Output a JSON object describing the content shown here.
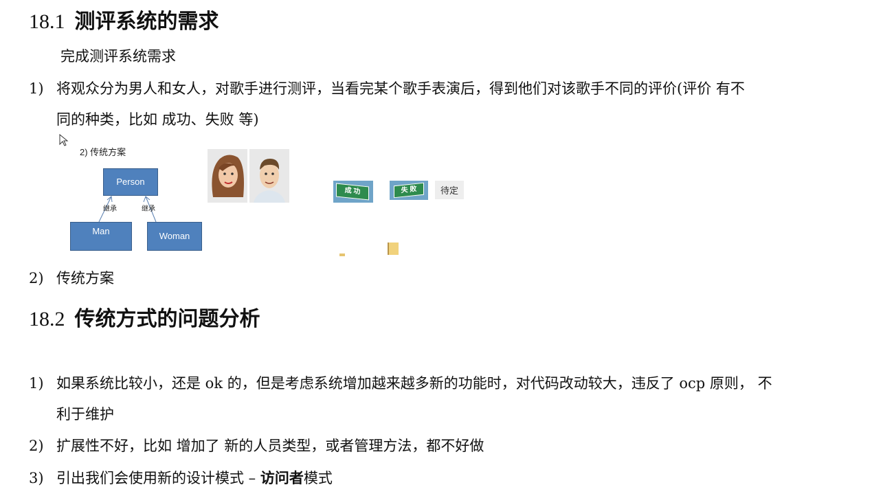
{
  "sec1": {
    "num": "18.1",
    "title": "测评系统的需求"
  },
  "intro": "完成测评系统需求",
  "req1": {
    "n": "1)",
    "line1": "将观众分为男人和女人，对歌手进行测评，当看完某个歌手表演后，得到他们对该歌手不同的评价(评价  有不",
    "line2": "同的种类，比如  成功、失败  等)"
  },
  "diagram": {
    "caption": "2)  传统方案",
    "person": "Person",
    "man": "Man",
    "woman": "Woman",
    "inherit1": "继承",
    "inherit2": "继承",
    "success": "成 功",
    "fail": "失 败",
    "pending": "待定"
  },
  "req2": {
    "n": "2)",
    "text": "传统方案"
  },
  "sec2": {
    "num": "18.2",
    "title": "传统方式的问题分析"
  },
  "problems": [
    {
      "n": "1)",
      "line1": "如果系统比较小，还是 ok 的，但是考虑系统增加越来越多新的功能时，对代码改动较大，违反了 ocp 原则，  不",
      "line2": "利于维护"
    },
    {
      "n": "2)",
      "text": "扩展性不好，比如  增加了  新的人员类型，或者管理方法，都不好做"
    },
    {
      "n": "3)",
      "prefix": "引出我们会使用新的设计模式  –  ",
      "bold": "访问者",
      "suffix": "模式"
    }
  ]
}
